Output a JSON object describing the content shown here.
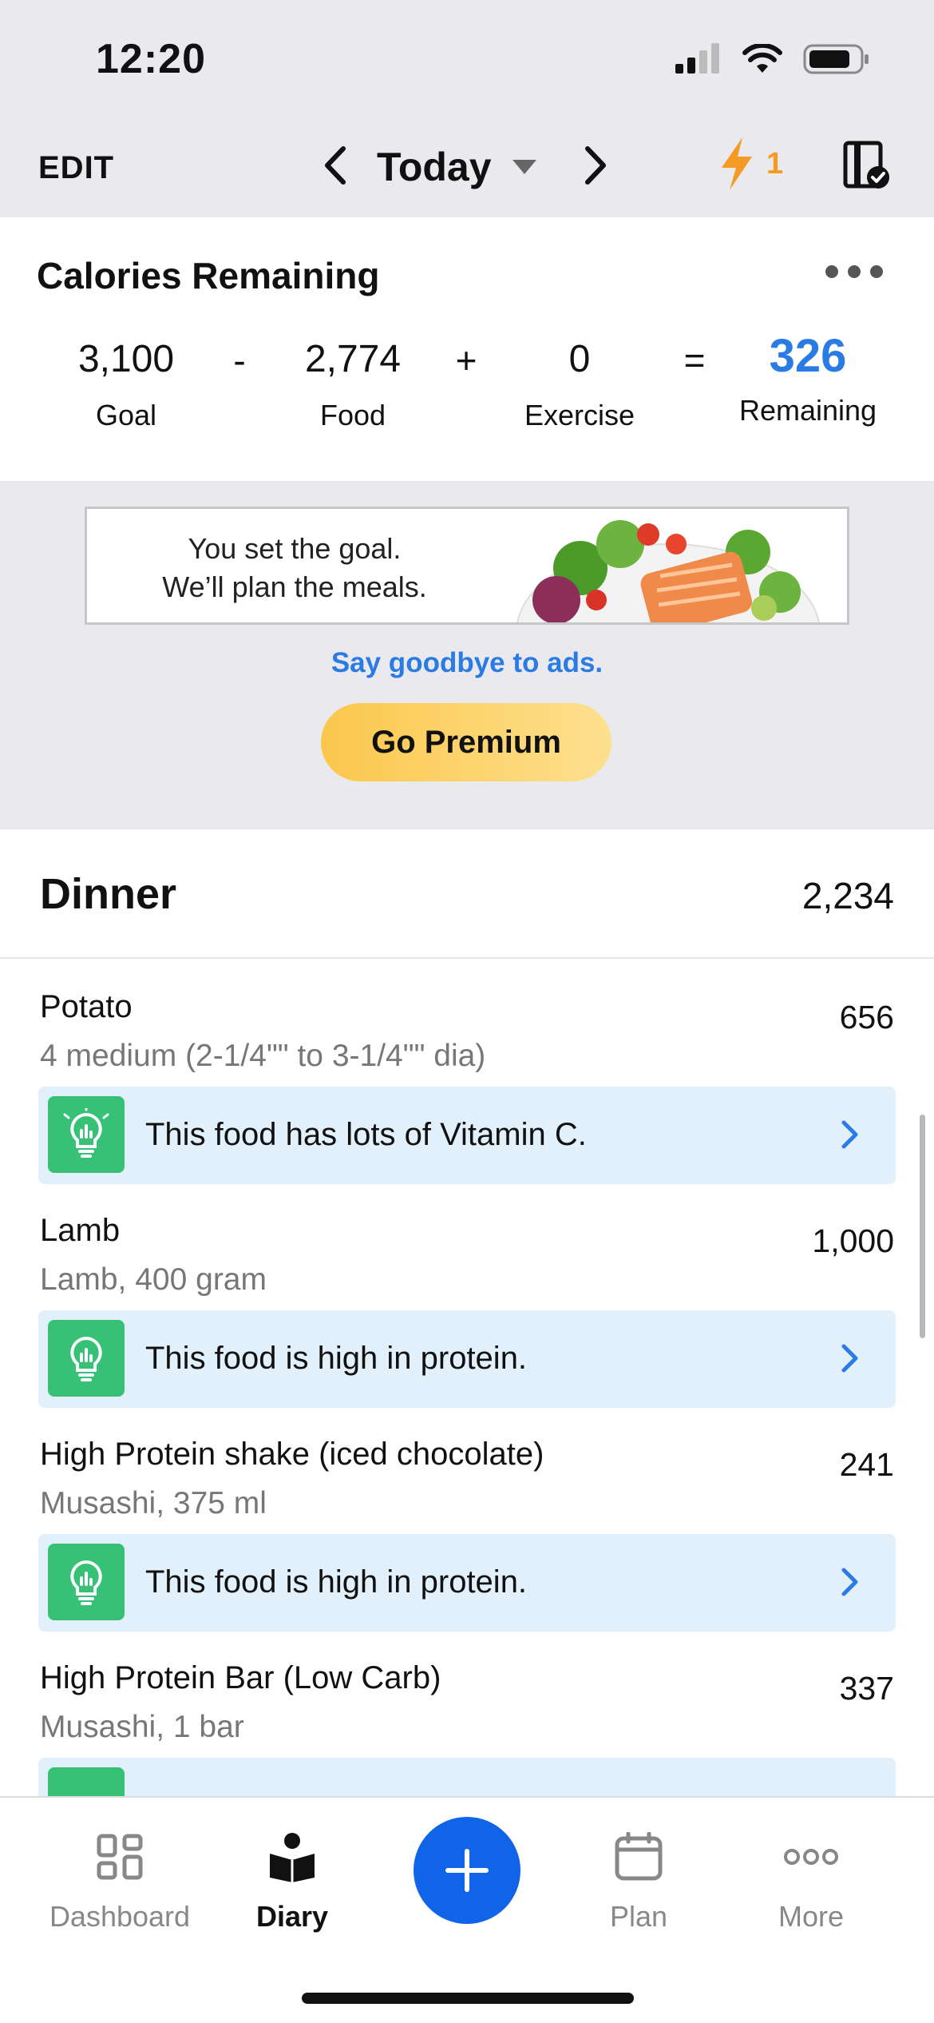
{
  "status_bar": {
    "time": "12:20"
  },
  "nav": {
    "edit_label": "EDIT",
    "title": "Today",
    "streak_count": "1"
  },
  "calories": {
    "title": "Calories Remaining",
    "goal_value": "3,100",
    "goal_label": "Goal",
    "minus": "-",
    "food_value": "2,774",
    "food_label": "Food",
    "plus": "+",
    "exercise_value": "0",
    "exercise_label": "Exercise",
    "equals": "=",
    "remaining_value": "326",
    "remaining_label": "Remaining"
  },
  "ad": {
    "line1": "You set the goal.",
    "line2": "We’ll plan the meals.",
    "goodbye": "Say goodbye to ads.",
    "premium_label": "Go Premium"
  },
  "meal": {
    "title": "Dinner",
    "total": "2,234",
    "items": [
      {
        "name": "Potato",
        "desc": "4 medium (2-1/4\"\" to 3-1/4\"\" dia)",
        "cal": "656",
        "tip": "This food has lots of Vitamin C."
      },
      {
        "name": "Lamb",
        "desc": "Lamb, 400 gram",
        "cal": "1,000",
        "tip": "This food is high in protein."
      },
      {
        "name": "High Protein shake (iced chocolate)",
        "desc": "Musashi, 375 ml",
        "cal": "241",
        "tip": "This food is high in protein."
      },
      {
        "name": "High Protein Bar (Low Carb)",
        "desc": "Musashi, 1 bar",
        "cal": "337",
        "tip": ""
      }
    ]
  },
  "tabs": [
    {
      "label": "Dashboard",
      "icon": "dashboard-icon"
    },
    {
      "label": "Diary",
      "icon": "diary-icon"
    },
    {
      "label": "Plan",
      "icon": "calendar-icon"
    },
    {
      "label": "More",
      "icon": "more-icon"
    }
  ],
  "colors": {
    "accent_blue": "#2a7be4",
    "add_button": "#0f64e8",
    "streak_orange": "#f59a23",
    "tip_green": "#36c177",
    "tip_bg": "#e1f0fb"
  }
}
